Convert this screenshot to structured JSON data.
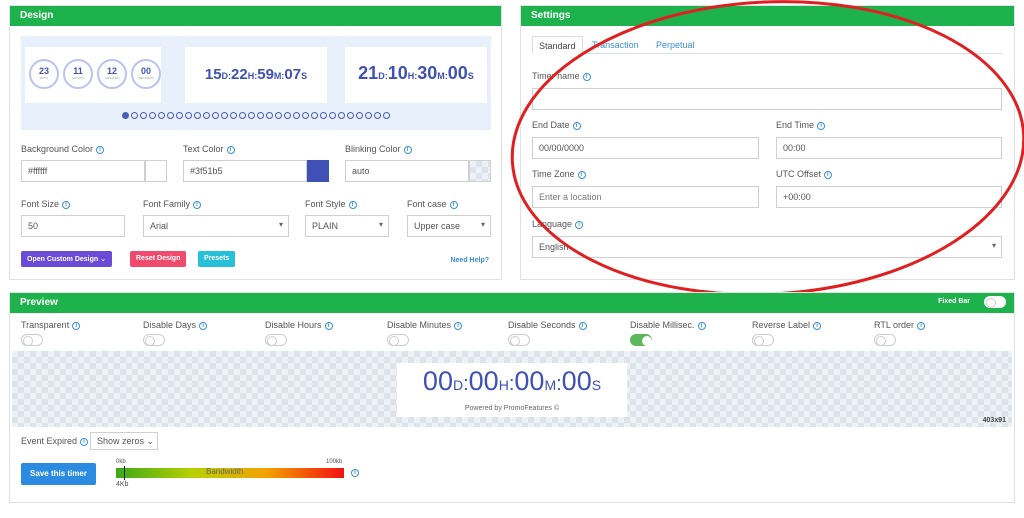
{
  "design": {
    "title": "Design",
    "preview1": {
      "circles": [
        {
          "n": "23",
          "u": "DAYS"
        },
        {
          "n": "11",
          "u": "HOURS"
        },
        {
          "n": "12",
          "u": "MINUTES"
        },
        {
          "n": "00",
          "u": "SECONDS"
        }
      ]
    },
    "preview2": {
      "d": "15",
      "h": "22",
      "m": "59",
      "s": "07"
    },
    "preview3": {
      "d": "21",
      "h": "10",
      "m": "30",
      "s": "00"
    },
    "bg_color_label": "Background Color",
    "bg_color_value": "#ffffff",
    "text_color_label": "Text Color",
    "text_color_value": "#3f51b5",
    "blink_color_label": "Blinking Color",
    "blink_color_value": "auto",
    "font_size_label": "Font Size",
    "font_size_value": "50",
    "font_family_label": "Font Family",
    "font_family_value": "Arial",
    "font_style_label": "Font Style",
    "font_style_value": "PLAIN",
    "font_case_label": "Font case",
    "font_case_value": "Upper case",
    "btn_open": "Open Custom Design",
    "btn_reset": "Reset Design",
    "btn_presets": "Presets",
    "need_help": "Need Help?"
  },
  "settings": {
    "title": "Settings",
    "tabs": [
      "Standard",
      "Transaction",
      "Perpetual"
    ],
    "timer_name_label": "Timer name",
    "timer_name_value": "",
    "end_date_label": "End Date",
    "end_date_value": "00/00/0000",
    "end_time_label": "End Time",
    "end_time_value": "00:00",
    "timezone_label": "Time Zone",
    "timezone_placeholder": "Enter a location",
    "utc_label": "UTC Offset",
    "utc_value": "+00:00",
    "language_label": "Language",
    "language_value": "English"
  },
  "preview": {
    "title": "Preview",
    "fixed_bar": "Fixed Bar",
    "toggles": [
      {
        "label": "Transparent",
        "on": false
      },
      {
        "label": "Disable Days",
        "on": false
      },
      {
        "label": "Disable Hours",
        "on": false
      },
      {
        "label": "Disable Minutes",
        "on": false
      },
      {
        "label": "Disable Seconds",
        "on": false
      },
      {
        "label": "Disable Millisec.",
        "on": true
      },
      {
        "label": "Reverse Label",
        "on": false
      },
      {
        "label": "RTL order",
        "on": false
      }
    ],
    "timer": {
      "d": "00",
      "h": "00",
      "m": "00",
      "s": "00"
    },
    "powered": "Powered by PromoFeatures ©",
    "size": "403x91",
    "event_expired_label": "Event Expired",
    "event_expired_value": "Show zeros",
    "save_btn": "Save this timer",
    "bw_min": "0kb",
    "bw_max": "100kb",
    "bw_label": "Bandwidth",
    "bw_value": "4Kb"
  },
  "colors": {
    "green": "#1eb24d",
    "accent": "#3f51b5",
    "ring": "#e02020"
  }
}
